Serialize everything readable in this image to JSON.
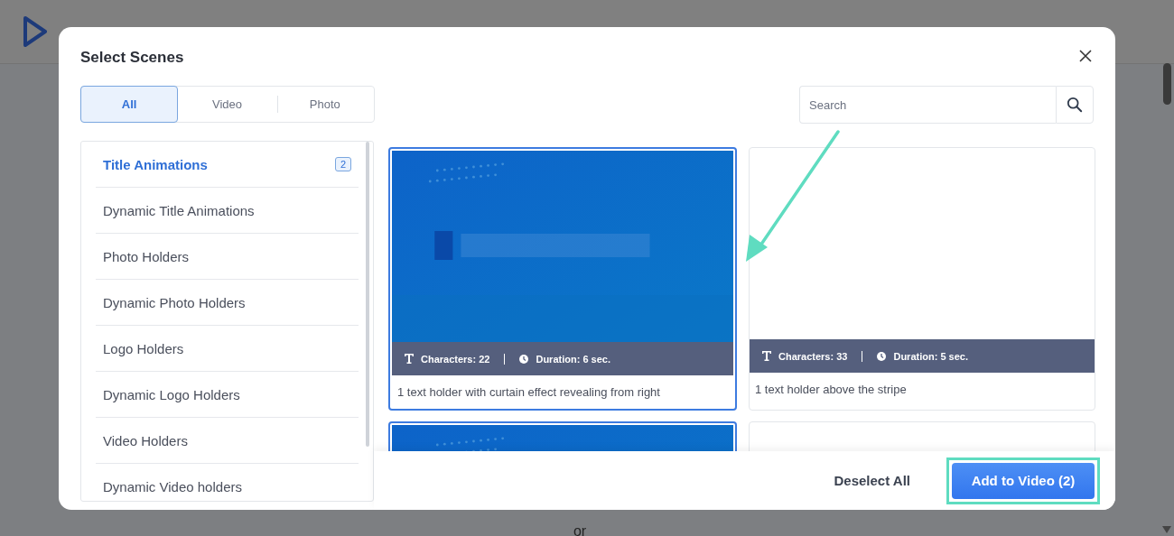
{
  "background": {
    "divider_text": "or"
  },
  "dialog": {
    "title": "Select Scenes",
    "tabs": [
      {
        "label": "All",
        "selected": true
      },
      {
        "label": "Video",
        "selected": false
      },
      {
        "label": "Photo",
        "selected": false
      }
    ],
    "search": {
      "placeholder": "Search"
    },
    "categories": [
      {
        "label": "Title Animations",
        "selected": true,
        "count": "2"
      },
      {
        "label": "Dynamic Title Animations",
        "selected": false
      },
      {
        "label": "Photo Holders",
        "selected": false
      },
      {
        "label": "Dynamic Photo Holders",
        "selected": false
      },
      {
        "label": "Logo Holders",
        "selected": false
      },
      {
        "label": "Dynamic Logo Holders",
        "selected": false
      },
      {
        "label": "Video Holders",
        "selected": false
      },
      {
        "label": "Dynamic Video holders",
        "selected": false
      }
    ],
    "scenes": [
      {
        "kind": "picture",
        "selected": true,
        "characters": "Characters: 22",
        "duration": "Duration: 6 sec.",
        "description": "1 text holder with curtain effect revealing from right"
      },
      {
        "kind": "blank",
        "selected": false,
        "characters": "Characters: 33",
        "duration": "Duration: 5 sec.",
        "description": "1 text holder above the stripe"
      },
      {
        "kind": "picture",
        "selected": true
      },
      {
        "kind": "blank",
        "selected": false
      }
    ],
    "footer": {
      "deselect": "Deselect All",
      "add": "Add to Video (2)",
      "add_highlighted": true
    }
  },
  "annotation_arrow": true
}
